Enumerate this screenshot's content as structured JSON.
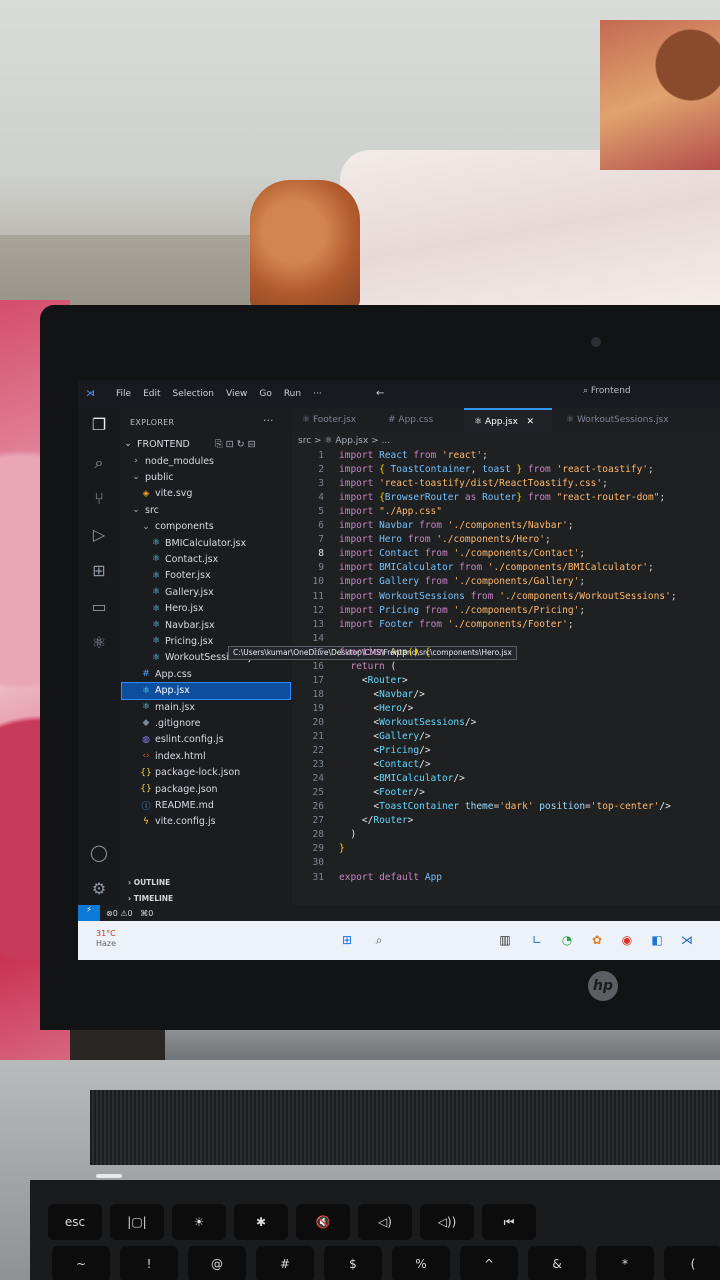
{
  "menubar": {
    "items": [
      "File",
      "Edit",
      "Selection",
      "View",
      "Go",
      "Run"
    ],
    "more": "···",
    "search": "Frontend"
  },
  "sidebar": {
    "title": "EXPLORER",
    "more": "···",
    "root": "FRONTEND",
    "tree": [
      {
        "label": "node_modules",
        "icon": "chevron-right"
      },
      {
        "label": "public",
        "icon": "chevron-down"
      },
      {
        "label": "vite.svg",
        "icon": "svg-file"
      },
      {
        "label": "src",
        "icon": "chevron-down"
      },
      {
        "label": "components",
        "icon": "chevron-down"
      },
      {
        "label": "BMICalculator.jsx",
        "icon": "react-file"
      },
      {
        "label": "Contact.jsx",
        "icon": "react-file"
      },
      {
        "label": "Footer.jsx",
        "icon": "react-file"
      },
      {
        "label": "Gallery.jsx",
        "icon": "react-file"
      },
      {
        "label": "Hero.jsx",
        "icon": "react-file"
      },
      {
        "label": "Navbar.jsx",
        "icon": "react-file"
      },
      {
        "label": "Pricing.jsx",
        "icon": "react-file"
      },
      {
        "label": "WorkoutSessions.jsx",
        "icon": "react-file"
      },
      {
        "label": "App.css",
        "icon": "css-file"
      },
      {
        "label": "App.jsx",
        "icon": "react-file"
      },
      {
        "label": "main.jsx",
        "icon": "react-file"
      },
      {
        "label": ".gitignore",
        "icon": "git-file"
      },
      {
        "label": "eslint.config.js",
        "icon": "eslint-file"
      },
      {
        "label": "index.html",
        "icon": "html-file"
      },
      {
        "label": "package-lock.json",
        "icon": "json-file"
      },
      {
        "label": "package.json",
        "icon": "json-file"
      },
      {
        "label": "README.md",
        "icon": "info-file"
      },
      {
        "label": "vite.config.js",
        "icon": "vite-file"
      }
    ],
    "tooltip": "C:\\Users\\kumar\\OneDrive\\Desktop\\CMS\\Frontend\\src\\components\\Hero.jsx",
    "outline": "OUTLINE",
    "timeline": "TIMELINE"
  },
  "tabs": [
    {
      "label": "Footer.jsx"
    },
    {
      "label": "App.css"
    },
    {
      "label": "App.jsx",
      "close": "✕"
    },
    {
      "label": "WorkoutSessions.jsx"
    }
  ],
  "breadcrumb": "src > ⚛ App.jsx > ...",
  "code_lines": [
    {
      "n": "1",
      "html": "<span class='kw'>import</span> <span class='id'>React</span> <span class='kw'>from</span> <span class='str'>'react'</span>;"
    },
    {
      "n": "2",
      "html": "<span class='kw'>import</span> <span class='br'>{</span> <span class='id'>ToastContainer</span>, <span class='id'>toast</span> <span class='br'>}</span> <span class='kw'>from</span> <span class='str'>'react-toastify'</span>;"
    },
    {
      "n": "3",
      "html": "<span class='kw'>import</span> <span class='str'>'react-toastify/dist/ReactToastify.css'</span>;"
    },
    {
      "n": "4",
      "html": "<span class='kw'>import</span> <span class='br'>{</span><span class='id'>BrowserRouter</span> <span class='kw'>as</span> <span class='id'>Router</span><span class='br'>}</span> <span class='kw'>from</span> <span class='str'>\"react-router-dom\"</span>;"
    },
    {
      "n": "5",
      "html": "<span class='kw'>import</span> <span class='str'>\"./App.css\"</span>"
    },
    {
      "n": "6",
      "html": "<span class='kw'>import</span> <span class='id'>Navbar</span> <span class='kw'>from</span> <span class='str'>'./components/Navbar'</span>;"
    },
    {
      "n": "7",
      "html": "<span class='kw'>import</span> <span class='id'>Hero</span> <span class='kw'>from</span> <span class='str'>'./components/Hero'</span>;"
    },
    {
      "n": "8",
      "html": "<span class='kw'>import</span> <span class='id'>Contact</span> <span class='kw'>from</span> <span class='str'>'./components/Contact'</span>;"
    },
    {
      "n": "9",
      "html": "<span class='kw'>import</span> <span class='id'>BMICalculator</span> <span class='kw'>from</span> <span class='str'>'./components/BMICalculator'</span>;"
    },
    {
      "n": "10",
      "html": "<span class='kw'>import</span> <span class='id'>Gallery</span> <span class='kw'>from</span> <span class='str'>'./components/Gallery'</span>;"
    },
    {
      "n": "11",
      "html": "<span class='kw'>import</span> <span class='id'>WorkoutSessions</span> <span class='kw'>from</span> <span class='str'>'./components/WorkoutSessions'</span>;"
    },
    {
      "n": "12",
      "html": "<span class='kw'>import</span> <span class='id'>Pricing</span> <span class='kw'>from</span> <span class='str'>'./components/Pricing'</span>;"
    },
    {
      "n": "13",
      "html": "<span class='kw'>import</span> <span class='id'>Footer</span> <span class='kw'>from</span> <span class='str'>'./components/Footer'</span>;"
    },
    {
      "n": "14",
      "html": ""
    },
    {
      "n": "15",
      "html": "<span class='kw'>function</span> <span class='fn'>App</span><span class='br'>()</span> <span class='br'>{</span>"
    },
    {
      "n": "16",
      "html": "  <span class='kw'>return</span> <span class='pl'>(</span>"
    },
    {
      "n": "17",
      "html": "    <span class='pl'>&lt;</span><span class='tag'>Router</span><span class='pl'>&gt;</span>"
    },
    {
      "n": "18",
      "html": "      <span class='pl'>&lt;</span><span class='tag'>Navbar</span><span class='pl'>/&gt;</span>"
    },
    {
      "n": "19",
      "html": "      <span class='pl'>&lt;</span><span class='tag'>Hero</span><span class='pl'>/&gt;</span>"
    },
    {
      "n": "20",
      "html": "      <span class='pl'>&lt;</span><span class='tag'>WorkoutSessions</span><span class='pl'>/&gt;</span>"
    },
    {
      "n": "21",
      "html": "      <span class='pl'>&lt;</span><span class='tag'>Gallery</span><span class='pl'>/&gt;</span>"
    },
    {
      "n": "22",
      "html": "      <span class='pl'>&lt;</span><span class='tag'>Pricing</span><span class='pl'>/&gt;</span>"
    },
    {
      "n": "23",
      "html": "      <span class='pl'>&lt;</span><span class='tag'>Contact</span><span class='pl'>/&gt;</span>"
    },
    {
      "n": "24",
      "html": "      <span class='pl'>&lt;</span><span class='tag'>BMICalculator</span><span class='pl'>/&gt;</span>"
    },
    {
      "n": "25",
      "html": "      <span class='pl'>&lt;</span><span class='tag'>Footer</span><span class='pl'>/&gt;</span>"
    },
    {
      "n": "26",
      "html": "      <span class='pl'>&lt;</span><span class='tag'>ToastContainer</span> <span class='att'>theme</span>=<span class='str'>'dark'</span> <span class='att'>position</span>=<span class='str'>'top-center'</span><span class='pl'>/&gt;</span>"
    },
    {
      "n": "27",
      "html": "    <span class='pl'>&lt;/</span><span class='tag'>Router</span><span class='pl'>&gt;</span>"
    },
    {
      "n": "28",
      "html": "  <span class='pl'>)</span>"
    },
    {
      "n": "29",
      "html": "<span class='br'>}</span>"
    },
    {
      "n": "30",
      "html": ""
    },
    {
      "n": "31",
      "html": "<span class='kw'>export</span> <span class='kw'>default</span> <span class='id'>App</span>"
    }
  ],
  "current_line": "8",
  "statusbar": {
    "errors": "⊗0 ⚠0",
    "ports": "⌘0"
  },
  "taskbar": {
    "weather_temp": "31°C",
    "weather_desc": "Haze"
  },
  "keyboard": [
    {
      "label": "esc"
    },
    {
      "label": "|▢|"
    },
    {
      "label": "☀"
    },
    {
      "label": "✱"
    },
    {
      "label": "🔇"
    },
    {
      "label": "◁)"
    },
    {
      "label": "◁))"
    },
    {
      "label": "⏮"
    }
  ],
  "keyboard_row2": [
    {
      "label": "~"
    },
    {
      "label": "!"
    },
    {
      "label": "@"
    },
    {
      "label": "#"
    },
    {
      "label": "$"
    },
    {
      "label": "%"
    },
    {
      "label": "^"
    },
    {
      "label": "&"
    },
    {
      "label": "*"
    },
    {
      "label": "("
    }
  ],
  "brand": "hp"
}
